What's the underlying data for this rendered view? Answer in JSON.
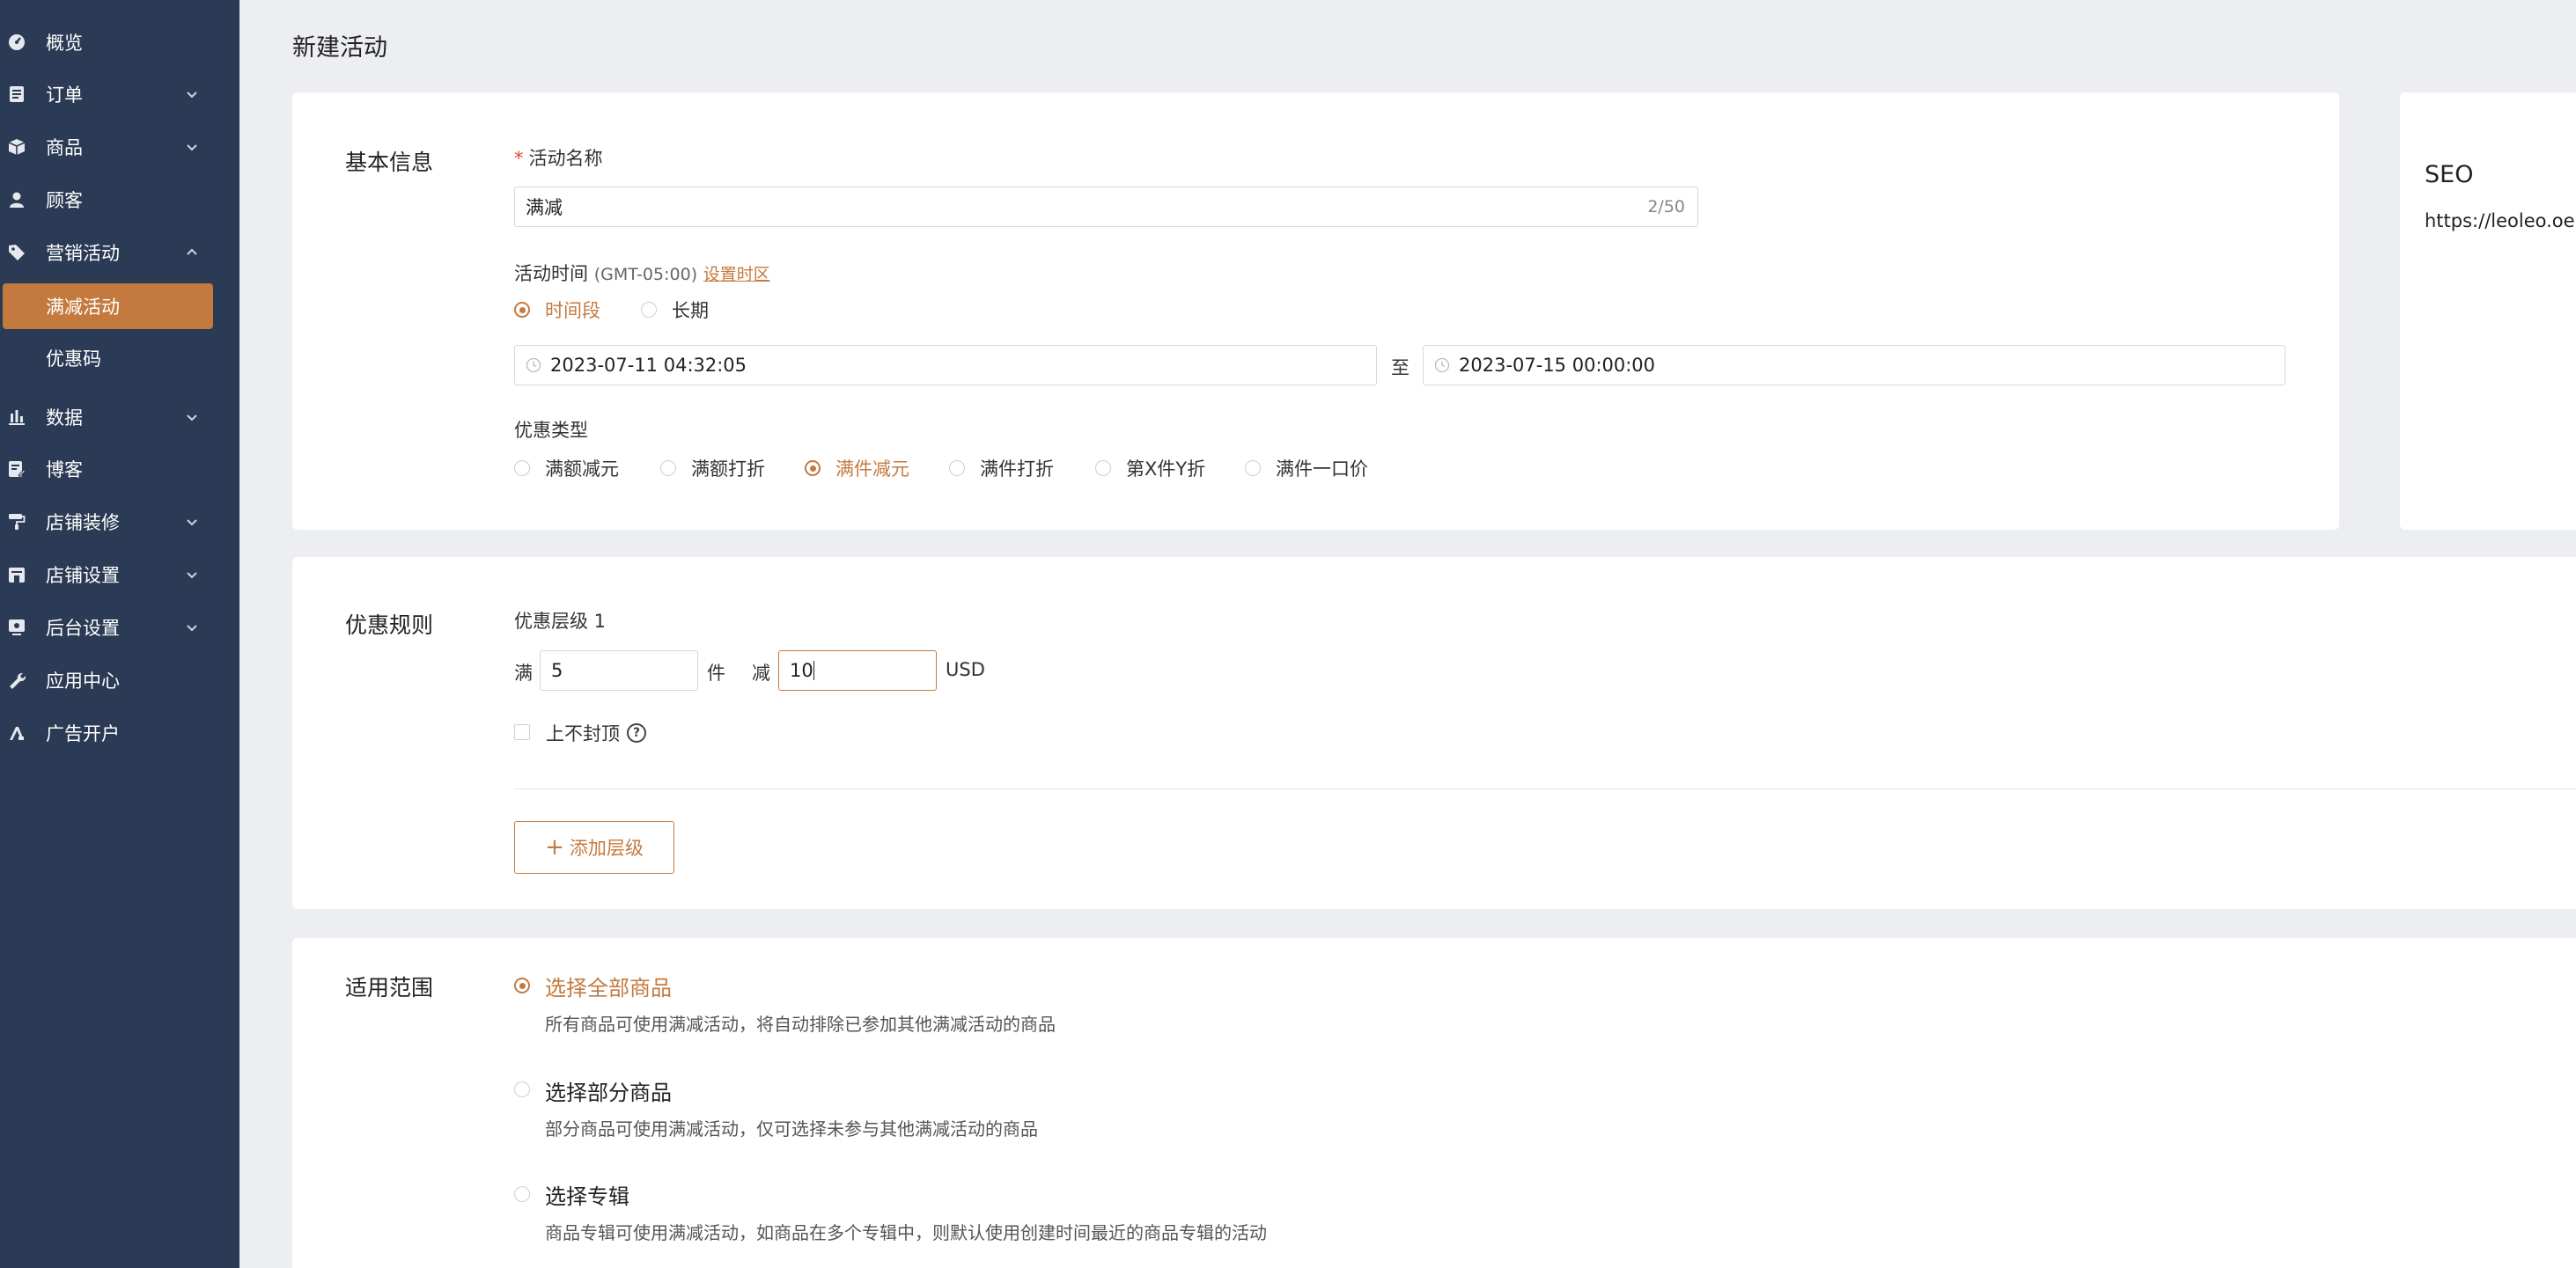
{
  "sidebar": {
    "items": [
      {
        "label": "概览",
        "icon": "dashboard-icon"
      },
      {
        "label": "订单",
        "icon": "order-icon"
      },
      {
        "label": "商品",
        "icon": "product-box-icon"
      },
      {
        "label": "顾客",
        "icon": "user-icon"
      },
      {
        "label": "营销活动",
        "icon": "tag-icon"
      },
      {
        "label": "数据",
        "icon": "bar-chart-icon"
      },
      {
        "label": "博客",
        "icon": "blog-edit-icon"
      },
      {
        "label": "店铺装修",
        "icon": "paint-roller-icon"
      },
      {
        "label": "店铺设置",
        "icon": "store-icon"
      },
      {
        "label": "后台设置",
        "icon": "monitor-settings-icon"
      },
      {
        "label": "应用中心",
        "icon": "wrench-icon"
      },
      {
        "label": "广告开户",
        "icon": "ads-icon"
      }
    ],
    "marketing_sub": [
      {
        "label": "满减活动",
        "active": true
      },
      {
        "label": "优惠码",
        "active": false
      }
    ]
  },
  "page": {
    "title": "新建活动"
  },
  "basic": {
    "section_title": "基本信息",
    "name_label": "活动名称",
    "name_value": "满减",
    "name_counter": "2/50",
    "time_label": "活动时间",
    "timezone": "(GMT-05:00)",
    "timezone_link": "设置时区",
    "time_options": [
      "时间段",
      "长期"
    ],
    "start_time": "2023-07-11 04:32:05",
    "to_label": "至",
    "end_time": "2023-07-15 00:00:00",
    "discount_type_label": "优惠类型",
    "discount_types": [
      "满额减元",
      "满额打折",
      "满件减元",
      "满件打折",
      "第X件Y折",
      "满件一口价"
    ]
  },
  "seo": {
    "title": "SEO",
    "url": "https://leoleo.oe"
  },
  "rules": {
    "section_title": "优惠规则",
    "tier_label": "优惠层级 1",
    "prefix": "满",
    "quantity": "5",
    "unit": "件",
    "minus": "减",
    "amount": "10",
    "currency": "USD",
    "no_cap_label": "上不封顶",
    "add_tier_label": "添加层级"
  },
  "scope": {
    "section_title": "适用范围",
    "options": [
      {
        "title": "选择全部商品",
        "desc": "所有商品可使用满减活动，将自动排除已参加其他满减活动的商品"
      },
      {
        "title": "选择部分商品",
        "desc": "部分商品可使用满减活动，仅可选择未参与其他满减活动的商品"
      },
      {
        "title": "选择专辑",
        "desc": "商品专辑可使用满减活动，如商品在多个专辑中，则默认使用创建时间最近的商品专辑的活动"
      }
    ]
  },
  "colors": {
    "sidebar_bg": "#2b3a55",
    "accent": "#c47a3f",
    "page_bg": "#eceef2"
  }
}
